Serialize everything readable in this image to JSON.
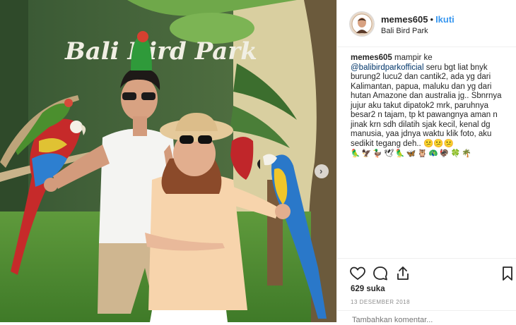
{
  "post": {
    "username": "memes605",
    "dot": "•",
    "follow_label": "Ikuti",
    "location": "Bali Bird Park",
    "photo_sign": "Bali Bird Park",
    "caption": {
      "username": "memes605",
      "lead": "mampir ke",
      "mention": "@balibirdparkofficial",
      "body": "seru bgt liat bnyk burung2 lucu2 dan cantik2, ada yg dari Kalimantan, papua, maluku dan yg dari hutan Amazone dan australia jg.. Sbnrnya jujur aku takut dipatok2 mrk, paruhnya besar2 n tajam, tp kt pawangnya aman n jinak krn sdh dilatih sjak kecil, kenal dg manusia, yaa jdnya waktu klik foto, aku sedikit tegang deh..",
      "emoji_end": "😕😕😕",
      "emoji_row": "🦜🦅🦆🕊🦜🦋🦉🦚🦃🍀🌴"
    },
    "likes": "629 suka",
    "date": "13 DESEMBER 2018",
    "comment_placeholder": "Tambahkan komentar..."
  },
  "icons": {
    "like": "heart-icon",
    "comment": "comment-bubble-icon",
    "share": "share-icon",
    "save": "bookmark-icon",
    "next": "chevron-right-icon"
  },
  "colors": {
    "follow": "#3897f0",
    "mention": "#003569",
    "muted": "#8e8e8e",
    "border": "#efefef"
  }
}
